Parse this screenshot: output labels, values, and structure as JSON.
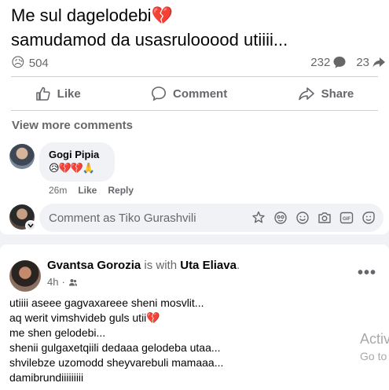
{
  "post": {
    "text_line1": "Me sul dagelodebi💔",
    "text_line2": "samudamod da usasrulooood utiiii...",
    "reaction_emoji": "😥",
    "reaction_count": "504",
    "comments_count": "232",
    "shares_count": "23"
  },
  "actions": {
    "like": "Like",
    "comment": "Comment",
    "share": "Share"
  },
  "comments": {
    "view_more": "View more comments",
    "items": [
      {
        "author": "Gogi Pipia",
        "text": "😥💔💔🙏",
        "time": "26m",
        "like": "Like",
        "reply": "Reply"
      }
    ],
    "composer_placeholder": "Comment as Tiko Gurashvili"
  },
  "post2": {
    "author": "Gvantsa Gorozia",
    "is_with": "is with",
    "with_name": "Uta Eliava",
    "period": ".",
    "time": "4h",
    "dot": "·",
    "lines": [
      "utiiii aseee gagvaxareee sheni mosvlit...",
      "aq werit vimshvideb guls utii💔",
      "me shen gelodebi...",
      "shenii gulgaxetqiili dedaaa gelodeba utaa...",
      "shvilebze uzomodd sheyvarebuli mamaaa...",
      "damibrundiiiiiiiii"
    ]
  },
  "watermark": {
    "line1": "Activ",
    "line2": "Go to"
  },
  "colors": {
    "background": "#f0f2f5",
    "card": "#ffffff",
    "secondary_text": "#65676b",
    "primary_text": "#050505"
  }
}
